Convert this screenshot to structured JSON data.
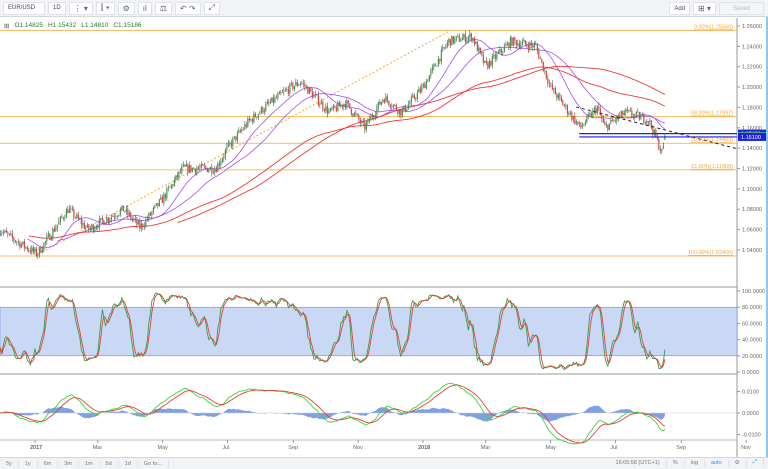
{
  "toolbar": {
    "symbol": "EUR/USD",
    "interval": "1D",
    "add_label": "Add",
    "saved_label": "Saved"
  },
  "ohlc": {
    "o_label": "O",
    "o": "1.14825",
    "h_label": "H",
    "h": "1.15432",
    "l_label": "L",
    "l": "1.14810",
    "c_label": "C",
    "c": "1.15186"
  },
  "bottom": {
    "ranges": [
      "5y",
      "1y",
      "6m",
      "3m",
      "1m",
      "5d",
      "1d"
    ],
    "goto": "Go to...",
    "time": "16:05:58 (UTC+1)",
    "percent": "%",
    "log": "log",
    "auto": "auto"
  },
  "chart_data": {
    "type": "candlestick",
    "symbol": "EUR/USD",
    "interval": "1D",
    "price_axis": {
      "range": [
        1.03,
        1.265
      ],
      "ticks": [
        "1.26000",
        "1.24000",
        "1.22000",
        "1.20000",
        "1.18000",
        "1.16000",
        "1.14000",
        "1.12000",
        "1.10000",
        "1.08000",
        "1.06000",
        "1.04000"
      ]
    },
    "price_tags": [
      {
        "value": "1.15431",
        "color": "#1e22e0"
      },
      {
        "value": "1.15186",
        "color": "#4caf78"
      },
      {
        "value": "1.15100",
        "color": "#1e22e0"
      }
    ],
    "time_axis": [
      "2017",
      "Mar",
      "May",
      "Jul",
      "Sep",
      "Nov",
      "2018",
      "Mar",
      "May",
      "Jul",
      "Sep",
      "Nov"
    ],
    "price_path": [
      [
        "2016-11-28",
        1.06
      ],
      [
        "2016-12-20",
        1.045
      ],
      [
        "2017-01-03",
        1.036
      ],
      [
        "2017-02-01",
        1.08
      ],
      [
        "2017-02-20",
        1.06
      ],
      [
        "2017-03-25",
        1.08
      ],
      [
        "2017-04-10",
        1.062
      ],
      [
        "2017-05-01",
        1.09
      ],
      [
        "2017-05-20",
        1.12
      ],
      [
        "2017-06-20",
        1.12
      ],
      [
        "2017-07-01",
        1.14
      ],
      [
        "2017-07-20",
        1.165
      ],
      [
        "2017-08-05",
        1.18
      ],
      [
        "2017-08-30",
        1.2
      ],
      [
        "2017-09-08",
        1.205
      ],
      [
        "2017-10-05",
        1.175
      ],
      [
        "2017-10-20",
        1.185
      ],
      [
        "2017-11-07",
        1.16
      ],
      [
        "2017-11-25",
        1.19
      ],
      [
        "2017-12-12",
        1.175
      ],
      [
        "2018-01-01",
        1.2
      ],
      [
        "2018-01-25",
        1.245
      ],
      [
        "2018-02-16",
        1.25
      ],
      [
        "2018-03-01",
        1.22
      ],
      [
        "2018-03-25",
        1.245
      ],
      [
        "2018-04-17",
        1.24
      ],
      [
        "2018-05-01",
        1.2
      ],
      [
        "2018-05-29",
        1.16
      ],
      [
        "2018-06-14",
        1.18
      ],
      [
        "2018-06-21",
        1.16
      ],
      [
        "2018-07-10",
        1.175
      ],
      [
        "2018-08-01",
        1.168
      ],
      [
        "2018-08-14",
        1.135
      ],
      [
        "2018-08-17",
        1.1519
      ]
    ],
    "fib_levels": [
      {
        "label": "0.00%(1.25560)",
        "value": 1.2556
      },
      {
        "label": "38.20%(1.17097)",
        "value": 1.17097
      },
      {
        "label": "50.00%(1.14483)",
        "value": 1.14483
      },
      {
        "label": "61.80%(1.11869)",
        "value": 1.11869
      },
      {
        "label": "100.00%(1.03406)",
        "value": 1.03406
      }
    ],
    "horizontal_lines": [
      1.15431,
      1.151
    ],
    "trend_line": {
      "from": [
        "2018-05-25",
        1.1805
      ],
      "to": [
        "2018-11-01",
        1.1395
      ]
    },
    "stochastic": {
      "ticks": [
        "100.0000",
        "80.0000",
        "60.0000",
        "40.0000",
        "20.0000",
        "0.0000"
      ],
      "band": [
        20,
        80
      ]
    },
    "macd": {
      "ticks": [
        "0.0100",
        "0.0000",
        "-0.0100"
      ]
    },
    "colors": {
      "up": "#3c9b46",
      "down": "#e0433a",
      "fib": "#f7a83a",
      "ma_purple": "#a452e8",
      "ma_red": "#ee3a3a",
      "band": "#c9d8f5"
    }
  }
}
